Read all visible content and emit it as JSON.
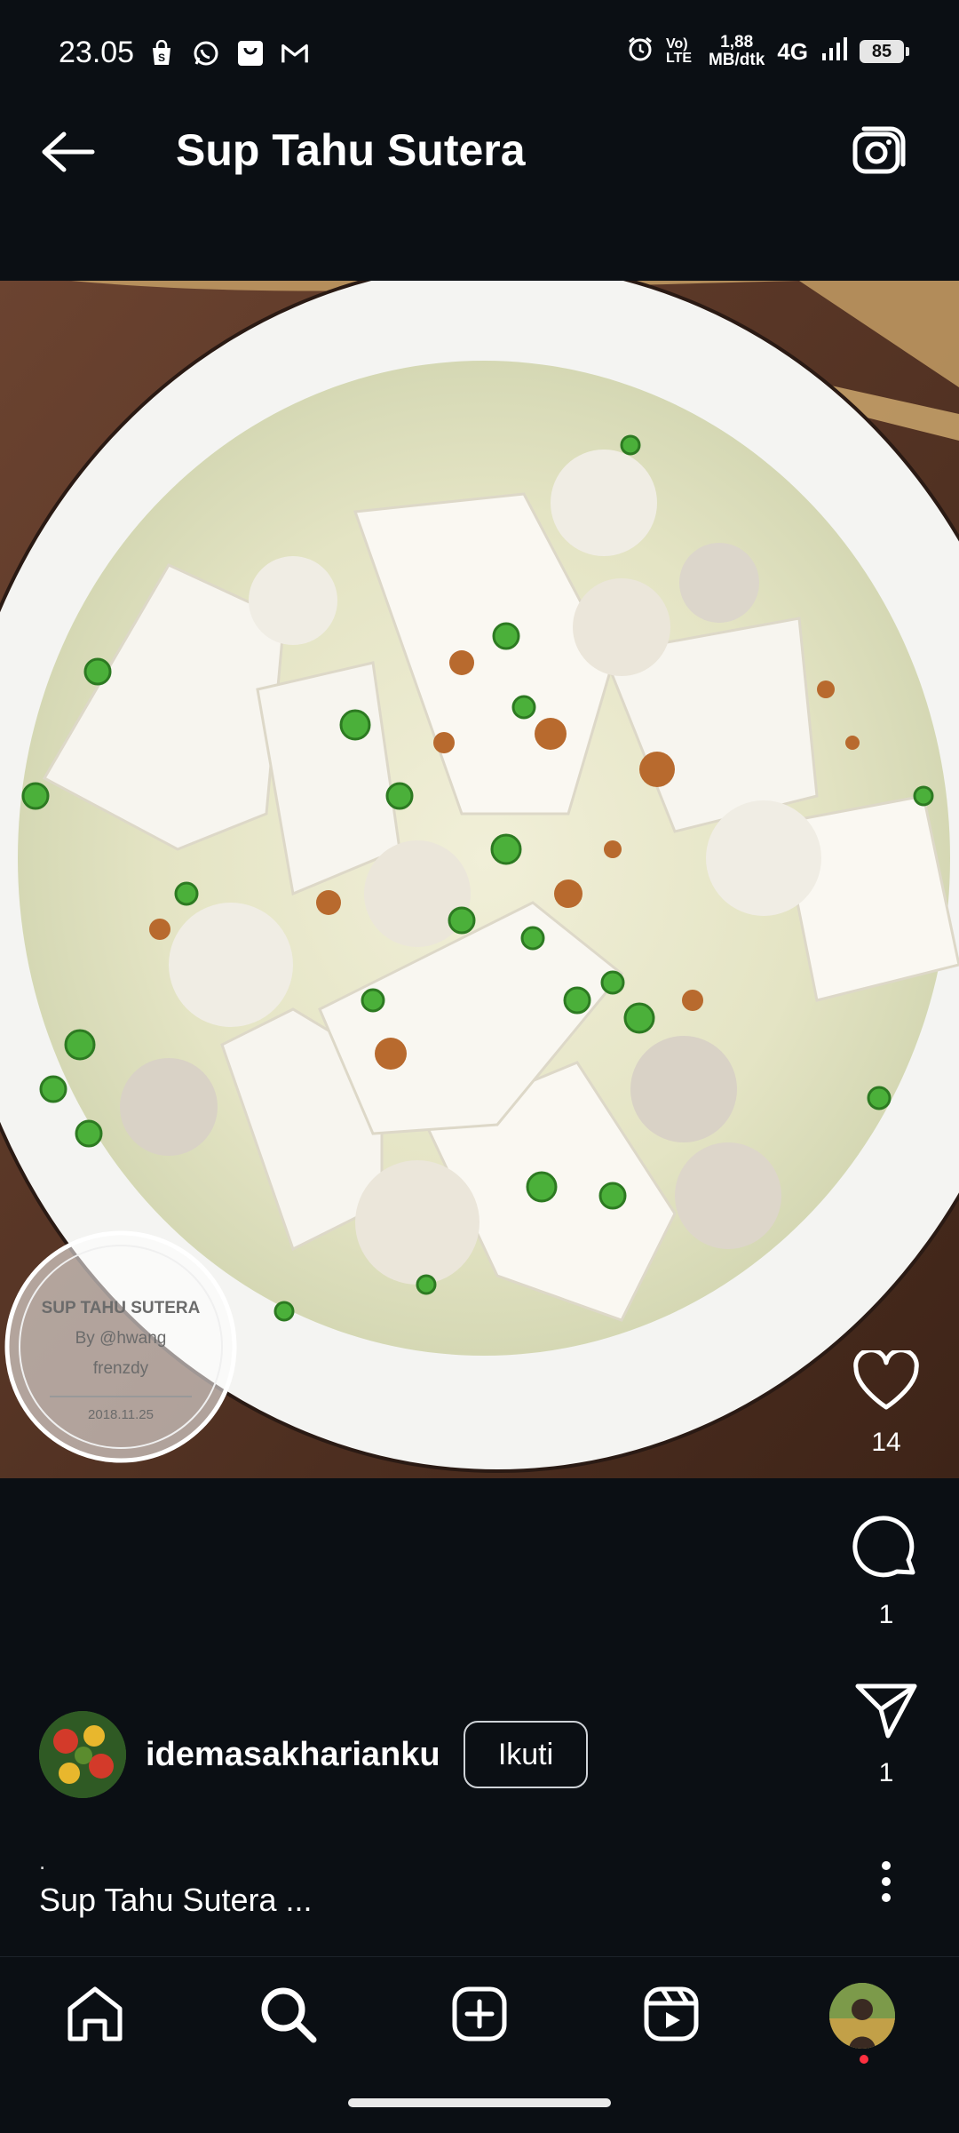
{
  "status_bar": {
    "time": "23.05",
    "net_speed_top": "1,88",
    "net_speed_bottom": "MB/dtk",
    "network": "4G",
    "lte": "Vo) LTE",
    "battery": "85"
  },
  "header": {
    "title": "Sup Tahu Sutera"
  },
  "post": {
    "watermark_title": "SUP TAHU SUTERA",
    "watermark_by": "By @hwang",
    "watermark_name": "frenzdy",
    "watermark_date": "2018.11.25"
  },
  "actions": {
    "likes": "14",
    "comments": "1",
    "shares": "1"
  },
  "author": {
    "username": "idemasakharianku",
    "follow_label": "Ikuti"
  },
  "caption": {
    "dot": ".",
    "text": "Sup Tahu Sutera ..."
  },
  "colors": {
    "background": "#0b0f14",
    "text": "#ffffff",
    "notification": "#ff3040"
  },
  "icons": {
    "back": "arrow-left-icon",
    "camera": "camera-icon",
    "like": "heart-icon",
    "comment": "comment-icon",
    "share": "send-icon",
    "more": "more-vertical-icon",
    "home": "home-icon",
    "search": "search-icon",
    "add": "add-post-icon",
    "reels": "reels-icon"
  }
}
